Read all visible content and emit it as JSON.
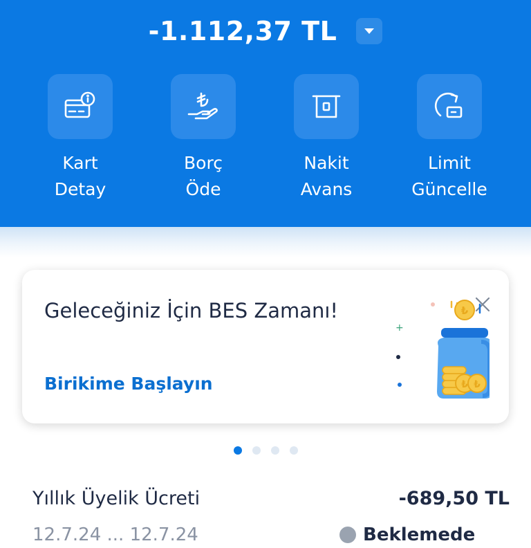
{
  "header": {
    "balance": "-1.112,37 TL",
    "bg_color": "#0b79e3"
  },
  "actions": [
    {
      "icon": "card-info-icon",
      "line1": "Kart",
      "line2": "Detay"
    },
    {
      "icon": "lira-hand-icon",
      "line1": "Borç",
      "line2": "Öde"
    },
    {
      "icon": "atm-cash-icon",
      "line1": "Nakit",
      "line2": "Avans"
    },
    {
      "icon": "limit-update-icon",
      "line1": "Limit",
      "line2": "Güncelle"
    }
  ],
  "promo": {
    "title": "Geleceğiniz İçin BES Zamanı!",
    "link": "Birikime Başlayın",
    "illustration_icon": "savings-jar-icon",
    "close_icon": "close-icon"
  },
  "carousel": {
    "count": 4,
    "active_index": 0
  },
  "fee": {
    "label": "Yıllık Üyelik Ücreti",
    "value": "-689,50 TL"
  },
  "next_row": {
    "left": "12.7.24 ... 12.7.24",
    "right": "Beklemede"
  },
  "colors": {
    "accent": "#0b79e3",
    "link": "#0b6fd0",
    "text": "#1f2a44"
  }
}
